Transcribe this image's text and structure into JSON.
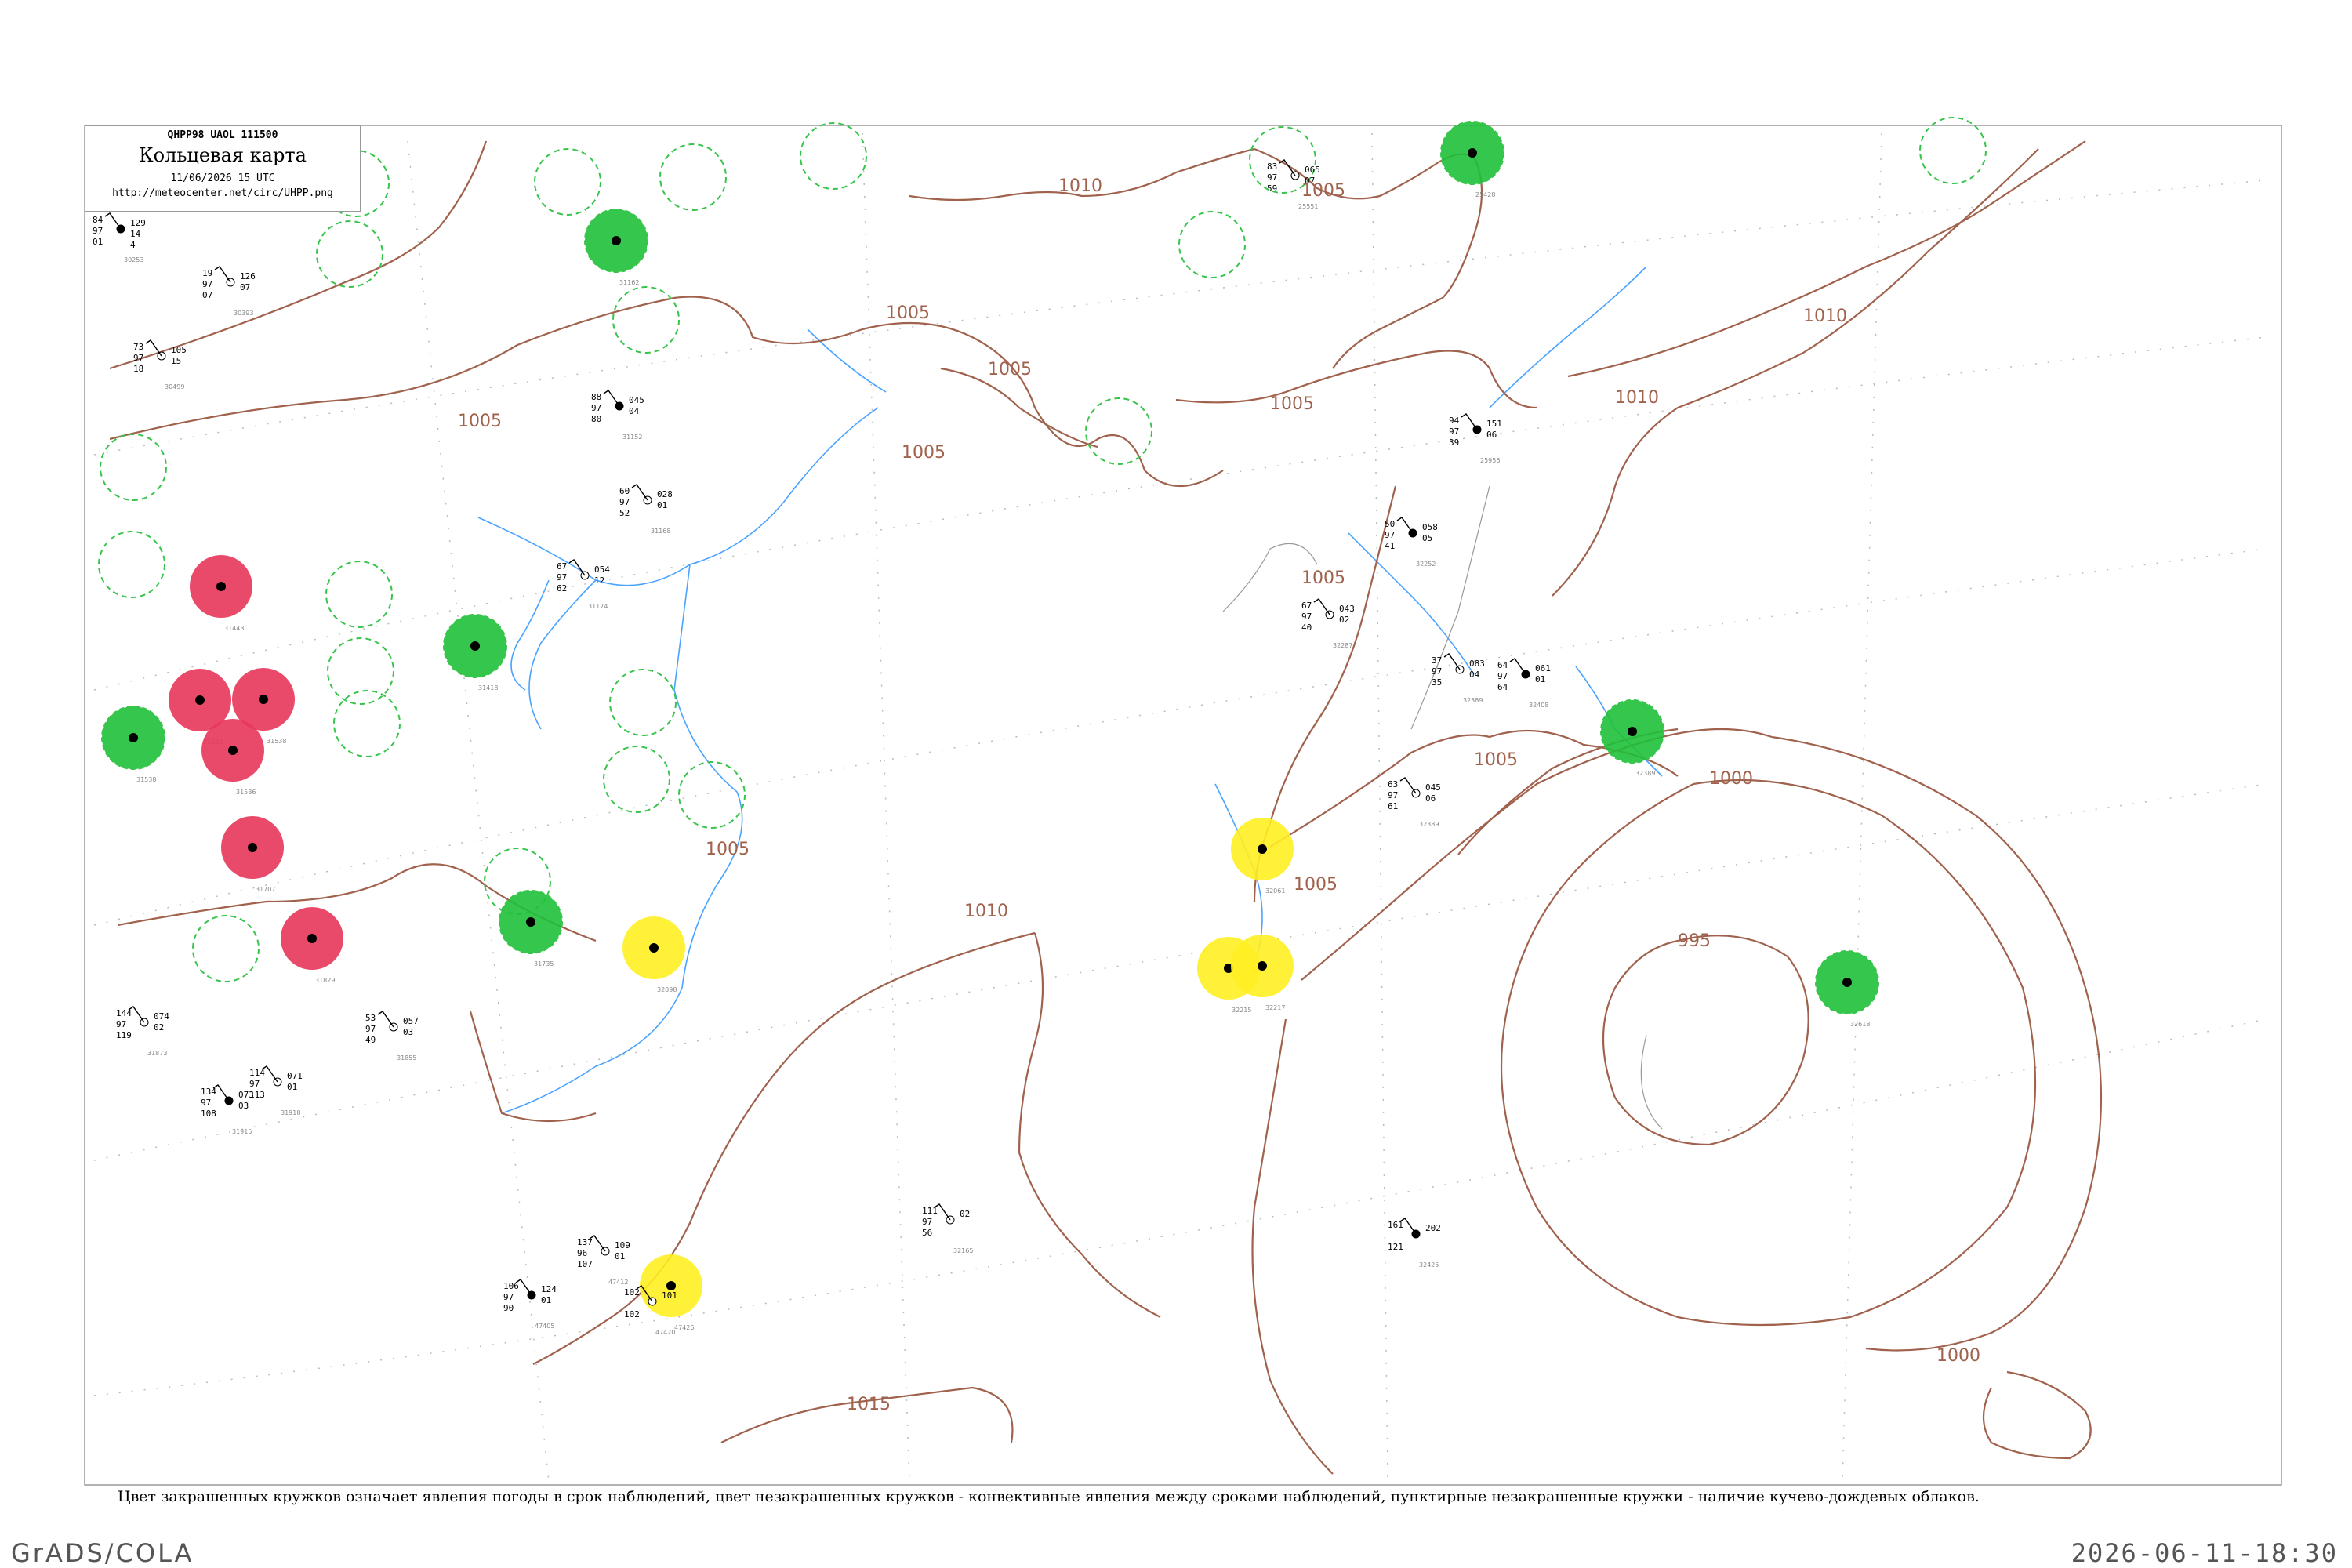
{
  "header": {
    "code": "QHPP98  UAOL  111500",
    "title": "Кольцевая карта",
    "datetime": "11/06/2026 15 UTC",
    "url": "http://meteocenter.net/circ/UHPP.png"
  },
  "caption": "Цвет закрашенных кружков означает явления погоды в срок наблюдений, цвет незакрашенных кружков - конвективные явления между сроками наблюдений, пунктирные незакрашенные кружки - наличие кучево-дождевых облаков.",
  "footer": {
    "left": "GrADS/COLA",
    "right": "2026-06-11-18:30"
  },
  "colors": {
    "isobar": "#a0624d",
    "river": "#4aa3ff",
    "red_event": "#e8365a",
    "green_event": "#1fc03a",
    "yellow_event": "#ffee22",
    "dashed_cb": "#37c44a"
  },
  "isobar_labels": [
    "1010",
    "1005",
    "1005",
    "1010",
    "1005",
    "1005",
    "1005",
    "1010",
    "1005",
    "1005",
    "1005",
    "1005",
    "1005",
    "1000",
    "995",
    "1010",
    "1015",
    "1000"
  ],
  "stations": [
    {
      "id": "30253",
      "a": "84",
      "b": "97",
      "c": "01",
      "d": "129",
      "e": "14",
      "f": "4"
    },
    {
      "id": "30393",
      "a": "19",
      "b": "97",
      "c": "07",
      "d": "126",
      "e": "07"
    },
    {
      "id": "30499",
      "a": "73",
      "b": "97",
      "c": "18",
      "d": "105",
      "e": "15"
    },
    {
      "id": "31152",
      "a": "88",
      "b": "97",
      "c": "80",
      "d": "045",
      "e": "04"
    },
    {
      "id": "31168",
      "a": "60",
      "b": "97",
      "c": "52",
      "d": "028",
      "e": "01"
    },
    {
      "id": "31174",
      "a": "67",
      "b": "97",
      "c": "62",
      "d": "054",
      "e": "12"
    },
    {
      "id": "32252",
      "a": "50",
      "b": "97",
      "c": "41",
      "d": "058",
      "e": "05"
    },
    {
      "id": "32287",
      "a": "67",
      "b": "97",
      "c": "40",
      "d": "043",
      "e": "02"
    },
    {
      "id": "32389",
      "a": "37",
      "b": "97",
      "c": "35",
      "d": "083",
      "e": "04"
    },
    {
      "id": "32408",
      "a": "64",
      "b": "97",
      "c": "64",
      "d": "061",
      "e": "01"
    },
    {
      "id": "32389",
      "a": "63",
      "b": "97",
      "c": "61",
      "d": "045",
      "e": "06"
    },
    {
      "id": "25551",
      "a": "83",
      "b": "97",
      "c": "59",
      "d": "065",
      "e": "07"
    },
    {
      "id": "25956",
      "a": "94",
      "b": "97",
      "c": "39",
      "d": "151",
      "e": "06"
    },
    {
      "id": "31855",
      "a": "53",
      "b": "97",
      "c": "49",
      "d": "057",
      "e": "03"
    },
    {
      "id": "31873",
      "a": "144",
      "b": "97",
      "c": "119",
      "d": "074",
      "e": "02"
    },
    {
      "id": "31915",
      "a": "134",
      "b": "97",
      "c": "108",
      "d": "073",
      "e": "03"
    },
    {
      "id": "31918",
      "a": "114",
      "b": "97",
      "c": "113",
      "d": "071",
      "e": "01"
    },
    {
      "id": "32165",
      "a": "111",
      "b": "97",
      "c": "56",
      "d": "02"
    },
    {
      "id": "32425",
      "a": "161",
      "b": "",
      "c": "121",
      "d": "202"
    },
    {
      "id": "47412",
      "a": "137",
      "b": "96",
      "c": "107",
      "d": "109",
      "e": "01"
    },
    {
      "id": "47420",
      "a": "102",
      "b": "",
      "c": "102",
      "d": "101"
    },
    {
      "id": "47405",
      "a": "106",
      "b": "97",
      "c": "90",
      "d": "124",
      "e": "01"
    }
  ],
  "circles": [
    {
      "kind": "red",
      "label": "31443"
    },
    {
      "kind": "red",
      "label": "31532"
    },
    {
      "kind": "red",
      "label": "31538"
    },
    {
      "kind": "red",
      "label": "31586"
    },
    {
      "kind": "red",
      "label": "31707"
    },
    {
      "kind": "red",
      "label": "31829"
    },
    {
      "kind": "green",
      "label": "31538"
    },
    {
      "kind": "green",
      "label": "31418"
    },
    {
      "kind": "green",
      "label": "31162"
    },
    {
      "kind": "green",
      "label": "31735"
    },
    {
      "kind": "green",
      "label": "25428"
    },
    {
      "kind": "green",
      "label": "32389"
    },
    {
      "kind": "green",
      "label": "32618"
    },
    {
      "kind": "yellow",
      "label": "32098"
    },
    {
      "kind": "yellow",
      "label": "32061"
    },
    {
      "kind": "yellow",
      "label": "32215"
    },
    {
      "kind": "yellow",
      "label": "32217"
    },
    {
      "kind": "yellow",
      "label": "47426"
    }
  ]
}
